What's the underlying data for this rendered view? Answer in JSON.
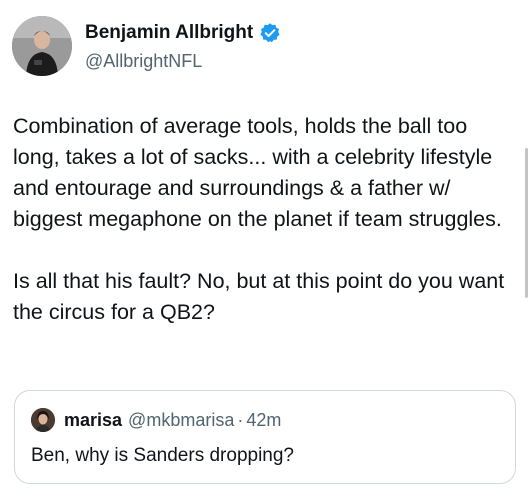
{
  "author": {
    "display_name": "Benjamin Allbright",
    "handle": "@AllbrightNFL",
    "verified": true,
    "verified_color": "#1d9bf0"
  },
  "tweet": {
    "paragraphs": [
      "Combination of average tools, holds the ball too long, takes a lot of sacks... with a celebrity lifestyle and entourage and surroundings & a father w/ biggest megaphone on the planet if team struggles.",
      "Is all that his fault? No, but at this point do you want the circus for a QB2?"
    ]
  },
  "quoted_tweet": {
    "display_name": "marisa",
    "handle": "@mkbmarisa",
    "separator": "·",
    "time": "42m",
    "text": "Ben, why is Sanders dropping?"
  },
  "colors": {
    "text_primary": "#0f1419",
    "text_secondary": "#536471",
    "border": "#cfd9de"
  }
}
